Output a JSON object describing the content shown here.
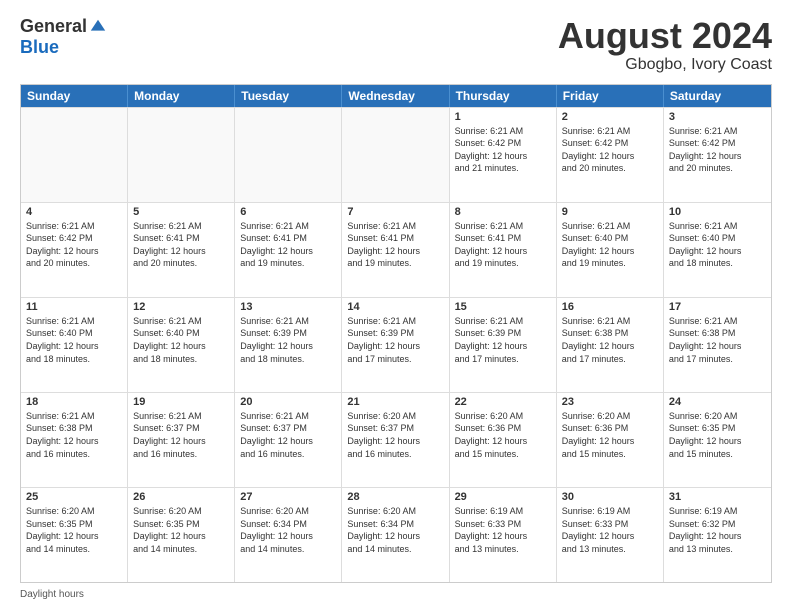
{
  "logo": {
    "general": "General",
    "blue": "Blue"
  },
  "title": "August 2024",
  "subtitle": "Gbogbo, Ivory Coast",
  "days": [
    "Sunday",
    "Monday",
    "Tuesday",
    "Wednesday",
    "Thursday",
    "Friday",
    "Saturday"
  ],
  "weeks": [
    [
      {
        "day": "",
        "info": ""
      },
      {
        "day": "",
        "info": ""
      },
      {
        "day": "",
        "info": ""
      },
      {
        "day": "",
        "info": ""
      },
      {
        "day": "1",
        "info": "Sunrise: 6:21 AM\nSunset: 6:42 PM\nDaylight: 12 hours\nand 21 minutes."
      },
      {
        "day": "2",
        "info": "Sunrise: 6:21 AM\nSunset: 6:42 PM\nDaylight: 12 hours\nand 20 minutes."
      },
      {
        "day": "3",
        "info": "Sunrise: 6:21 AM\nSunset: 6:42 PM\nDaylight: 12 hours\nand 20 minutes."
      }
    ],
    [
      {
        "day": "4",
        "info": "Sunrise: 6:21 AM\nSunset: 6:42 PM\nDaylight: 12 hours\nand 20 minutes."
      },
      {
        "day": "5",
        "info": "Sunrise: 6:21 AM\nSunset: 6:41 PM\nDaylight: 12 hours\nand 20 minutes."
      },
      {
        "day": "6",
        "info": "Sunrise: 6:21 AM\nSunset: 6:41 PM\nDaylight: 12 hours\nand 19 minutes."
      },
      {
        "day": "7",
        "info": "Sunrise: 6:21 AM\nSunset: 6:41 PM\nDaylight: 12 hours\nand 19 minutes."
      },
      {
        "day": "8",
        "info": "Sunrise: 6:21 AM\nSunset: 6:41 PM\nDaylight: 12 hours\nand 19 minutes."
      },
      {
        "day": "9",
        "info": "Sunrise: 6:21 AM\nSunset: 6:40 PM\nDaylight: 12 hours\nand 19 minutes."
      },
      {
        "day": "10",
        "info": "Sunrise: 6:21 AM\nSunset: 6:40 PM\nDaylight: 12 hours\nand 18 minutes."
      }
    ],
    [
      {
        "day": "11",
        "info": "Sunrise: 6:21 AM\nSunset: 6:40 PM\nDaylight: 12 hours\nand 18 minutes."
      },
      {
        "day": "12",
        "info": "Sunrise: 6:21 AM\nSunset: 6:40 PM\nDaylight: 12 hours\nand 18 minutes."
      },
      {
        "day": "13",
        "info": "Sunrise: 6:21 AM\nSunset: 6:39 PM\nDaylight: 12 hours\nand 18 minutes."
      },
      {
        "day": "14",
        "info": "Sunrise: 6:21 AM\nSunset: 6:39 PM\nDaylight: 12 hours\nand 17 minutes."
      },
      {
        "day": "15",
        "info": "Sunrise: 6:21 AM\nSunset: 6:39 PM\nDaylight: 12 hours\nand 17 minutes."
      },
      {
        "day": "16",
        "info": "Sunrise: 6:21 AM\nSunset: 6:38 PM\nDaylight: 12 hours\nand 17 minutes."
      },
      {
        "day": "17",
        "info": "Sunrise: 6:21 AM\nSunset: 6:38 PM\nDaylight: 12 hours\nand 17 minutes."
      }
    ],
    [
      {
        "day": "18",
        "info": "Sunrise: 6:21 AM\nSunset: 6:38 PM\nDaylight: 12 hours\nand 16 minutes."
      },
      {
        "day": "19",
        "info": "Sunrise: 6:21 AM\nSunset: 6:37 PM\nDaylight: 12 hours\nand 16 minutes."
      },
      {
        "day": "20",
        "info": "Sunrise: 6:21 AM\nSunset: 6:37 PM\nDaylight: 12 hours\nand 16 minutes."
      },
      {
        "day": "21",
        "info": "Sunrise: 6:20 AM\nSunset: 6:37 PM\nDaylight: 12 hours\nand 16 minutes."
      },
      {
        "day": "22",
        "info": "Sunrise: 6:20 AM\nSunset: 6:36 PM\nDaylight: 12 hours\nand 15 minutes."
      },
      {
        "day": "23",
        "info": "Sunrise: 6:20 AM\nSunset: 6:36 PM\nDaylight: 12 hours\nand 15 minutes."
      },
      {
        "day": "24",
        "info": "Sunrise: 6:20 AM\nSunset: 6:35 PM\nDaylight: 12 hours\nand 15 minutes."
      }
    ],
    [
      {
        "day": "25",
        "info": "Sunrise: 6:20 AM\nSunset: 6:35 PM\nDaylight: 12 hours\nand 14 minutes."
      },
      {
        "day": "26",
        "info": "Sunrise: 6:20 AM\nSunset: 6:35 PM\nDaylight: 12 hours\nand 14 minutes."
      },
      {
        "day": "27",
        "info": "Sunrise: 6:20 AM\nSunset: 6:34 PM\nDaylight: 12 hours\nand 14 minutes."
      },
      {
        "day": "28",
        "info": "Sunrise: 6:20 AM\nSunset: 6:34 PM\nDaylight: 12 hours\nand 14 minutes."
      },
      {
        "day": "29",
        "info": "Sunrise: 6:19 AM\nSunset: 6:33 PM\nDaylight: 12 hours\nand 13 minutes."
      },
      {
        "day": "30",
        "info": "Sunrise: 6:19 AM\nSunset: 6:33 PM\nDaylight: 12 hours\nand 13 minutes."
      },
      {
        "day": "31",
        "info": "Sunrise: 6:19 AM\nSunset: 6:32 PM\nDaylight: 12 hours\nand 13 minutes."
      }
    ]
  ],
  "footer": "Daylight hours"
}
